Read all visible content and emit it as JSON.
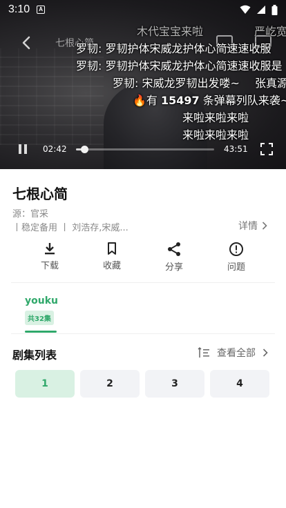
{
  "status": {
    "time": "3:10",
    "app_icon": "A"
  },
  "player": {
    "title": "七根心简",
    "current_time": "02:42",
    "duration": "43:51",
    "progress": 0.06
  },
  "danmaku": {
    "line0a": "木代宝宝来啦",
    "line0b": "严屹宽",
    "line1": "罗韧: 罗韧护体宋威龙护体心简速速收服",
    "line2": "罗韧: 罗韧护体宋威龙护体心简速速收服是",
    "line3a": "罗韧: 宋威龙罗韧出发喽~",
    "line3b": "张真源",
    "line4_prefix": "🔥有 ",
    "line4_count": "15497",
    "line4_suffix": " 条弹幕列队来袭~",
    "line5": "来啦来啦来啦",
    "line6": "来啦来啦来啦"
  },
  "info": {
    "title": "七根心简",
    "source_line": "源：官采",
    "sub_line": "丨稳定备用 丨 刘浩存,宋威...",
    "detail_label": "详情"
  },
  "actions": [
    {
      "icon": "download-icon",
      "label": "下载"
    },
    {
      "icon": "bookmark-icon",
      "label": "收藏"
    },
    {
      "icon": "share-icon",
      "label": "分享"
    },
    {
      "icon": "issue-icon",
      "label": "问题"
    }
  ],
  "source": {
    "name": "youku",
    "badge": "共32集"
  },
  "episodes": {
    "header": "剧集列表",
    "view_all": "查看全部",
    "items": [
      "1",
      "2",
      "3",
      "4"
    ],
    "active_index": 0
  },
  "colors": {
    "accent": "#2fa86a",
    "accent_bg": "#d9f1e3"
  }
}
